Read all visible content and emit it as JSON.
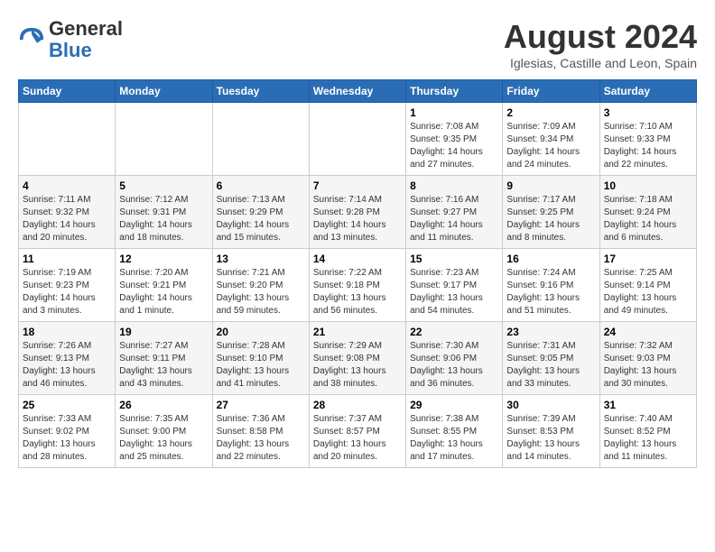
{
  "header": {
    "logo_general": "General",
    "logo_blue": "Blue",
    "month_year": "August 2024",
    "location": "Iglesias, Castille and Leon, Spain"
  },
  "days_of_week": [
    "Sunday",
    "Monday",
    "Tuesday",
    "Wednesday",
    "Thursday",
    "Friday",
    "Saturday"
  ],
  "weeks": [
    [
      {
        "day": "",
        "info": ""
      },
      {
        "day": "",
        "info": ""
      },
      {
        "day": "",
        "info": ""
      },
      {
        "day": "",
        "info": ""
      },
      {
        "day": "1",
        "info": "Sunrise: 7:08 AM\nSunset: 9:35 PM\nDaylight: 14 hours and 27 minutes."
      },
      {
        "day": "2",
        "info": "Sunrise: 7:09 AM\nSunset: 9:34 PM\nDaylight: 14 hours and 24 minutes."
      },
      {
        "day": "3",
        "info": "Sunrise: 7:10 AM\nSunset: 9:33 PM\nDaylight: 14 hours and 22 minutes."
      }
    ],
    [
      {
        "day": "4",
        "info": "Sunrise: 7:11 AM\nSunset: 9:32 PM\nDaylight: 14 hours and 20 minutes."
      },
      {
        "day": "5",
        "info": "Sunrise: 7:12 AM\nSunset: 9:31 PM\nDaylight: 14 hours and 18 minutes."
      },
      {
        "day": "6",
        "info": "Sunrise: 7:13 AM\nSunset: 9:29 PM\nDaylight: 14 hours and 15 minutes."
      },
      {
        "day": "7",
        "info": "Sunrise: 7:14 AM\nSunset: 9:28 PM\nDaylight: 14 hours and 13 minutes."
      },
      {
        "day": "8",
        "info": "Sunrise: 7:16 AM\nSunset: 9:27 PM\nDaylight: 14 hours and 11 minutes."
      },
      {
        "day": "9",
        "info": "Sunrise: 7:17 AM\nSunset: 9:25 PM\nDaylight: 14 hours and 8 minutes."
      },
      {
        "day": "10",
        "info": "Sunrise: 7:18 AM\nSunset: 9:24 PM\nDaylight: 14 hours and 6 minutes."
      }
    ],
    [
      {
        "day": "11",
        "info": "Sunrise: 7:19 AM\nSunset: 9:23 PM\nDaylight: 14 hours and 3 minutes."
      },
      {
        "day": "12",
        "info": "Sunrise: 7:20 AM\nSunset: 9:21 PM\nDaylight: 14 hours and 1 minute."
      },
      {
        "day": "13",
        "info": "Sunrise: 7:21 AM\nSunset: 9:20 PM\nDaylight: 13 hours and 59 minutes."
      },
      {
        "day": "14",
        "info": "Sunrise: 7:22 AM\nSunset: 9:18 PM\nDaylight: 13 hours and 56 minutes."
      },
      {
        "day": "15",
        "info": "Sunrise: 7:23 AM\nSunset: 9:17 PM\nDaylight: 13 hours and 54 minutes."
      },
      {
        "day": "16",
        "info": "Sunrise: 7:24 AM\nSunset: 9:16 PM\nDaylight: 13 hours and 51 minutes."
      },
      {
        "day": "17",
        "info": "Sunrise: 7:25 AM\nSunset: 9:14 PM\nDaylight: 13 hours and 49 minutes."
      }
    ],
    [
      {
        "day": "18",
        "info": "Sunrise: 7:26 AM\nSunset: 9:13 PM\nDaylight: 13 hours and 46 minutes."
      },
      {
        "day": "19",
        "info": "Sunrise: 7:27 AM\nSunset: 9:11 PM\nDaylight: 13 hours and 43 minutes."
      },
      {
        "day": "20",
        "info": "Sunrise: 7:28 AM\nSunset: 9:10 PM\nDaylight: 13 hours and 41 minutes."
      },
      {
        "day": "21",
        "info": "Sunrise: 7:29 AM\nSunset: 9:08 PM\nDaylight: 13 hours and 38 minutes."
      },
      {
        "day": "22",
        "info": "Sunrise: 7:30 AM\nSunset: 9:06 PM\nDaylight: 13 hours and 36 minutes."
      },
      {
        "day": "23",
        "info": "Sunrise: 7:31 AM\nSunset: 9:05 PM\nDaylight: 13 hours and 33 minutes."
      },
      {
        "day": "24",
        "info": "Sunrise: 7:32 AM\nSunset: 9:03 PM\nDaylight: 13 hours and 30 minutes."
      }
    ],
    [
      {
        "day": "25",
        "info": "Sunrise: 7:33 AM\nSunset: 9:02 PM\nDaylight: 13 hours and 28 minutes."
      },
      {
        "day": "26",
        "info": "Sunrise: 7:35 AM\nSunset: 9:00 PM\nDaylight: 13 hours and 25 minutes."
      },
      {
        "day": "27",
        "info": "Sunrise: 7:36 AM\nSunset: 8:58 PM\nDaylight: 13 hours and 22 minutes."
      },
      {
        "day": "28",
        "info": "Sunrise: 7:37 AM\nSunset: 8:57 PM\nDaylight: 13 hours and 20 minutes."
      },
      {
        "day": "29",
        "info": "Sunrise: 7:38 AM\nSunset: 8:55 PM\nDaylight: 13 hours and 17 minutes."
      },
      {
        "day": "30",
        "info": "Sunrise: 7:39 AM\nSunset: 8:53 PM\nDaylight: 13 hours and 14 minutes."
      },
      {
        "day": "31",
        "info": "Sunrise: 7:40 AM\nSunset: 8:52 PM\nDaylight: 13 hours and 11 minutes."
      }
    ]
  ]
}
